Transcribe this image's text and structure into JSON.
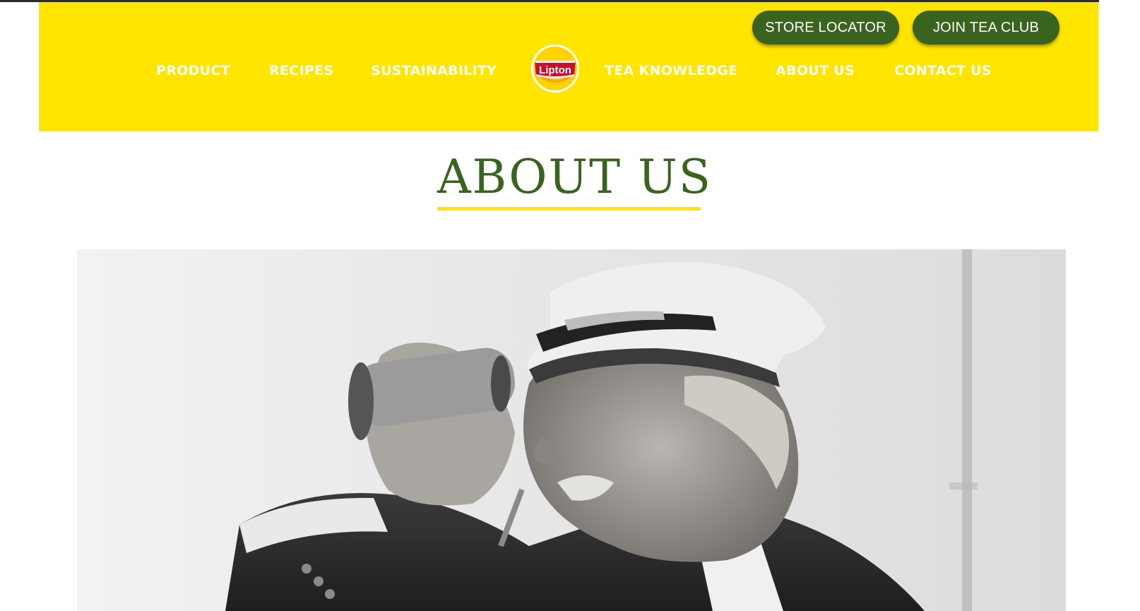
{
  "header": {
    "store_locator": "STORE LOCATOR",
    "join_tea_club": "JOIN TEA CLUB",
    "nav": [
      {
        "label": "PRODUCT"
      },
      {
        "label": "RECIPES"
      },
      {
        "label": "SUSTAINABILITY"
      },
      {
        "label": "TEA KNOWLEDGE"
      },
      {
        "label": "ABOUT US"
      },
      {
        "label": "CONTACT US"
      }
    ],
    "logo_text": "Lipton"
  },
  "main": {
    "title": "ABOUT US"
  },
  "colors": {
    "header_yellow": "#ffe500",
    "brand_green": "#3a6320",
    "logo_red": "#c8102e"
  }
}
